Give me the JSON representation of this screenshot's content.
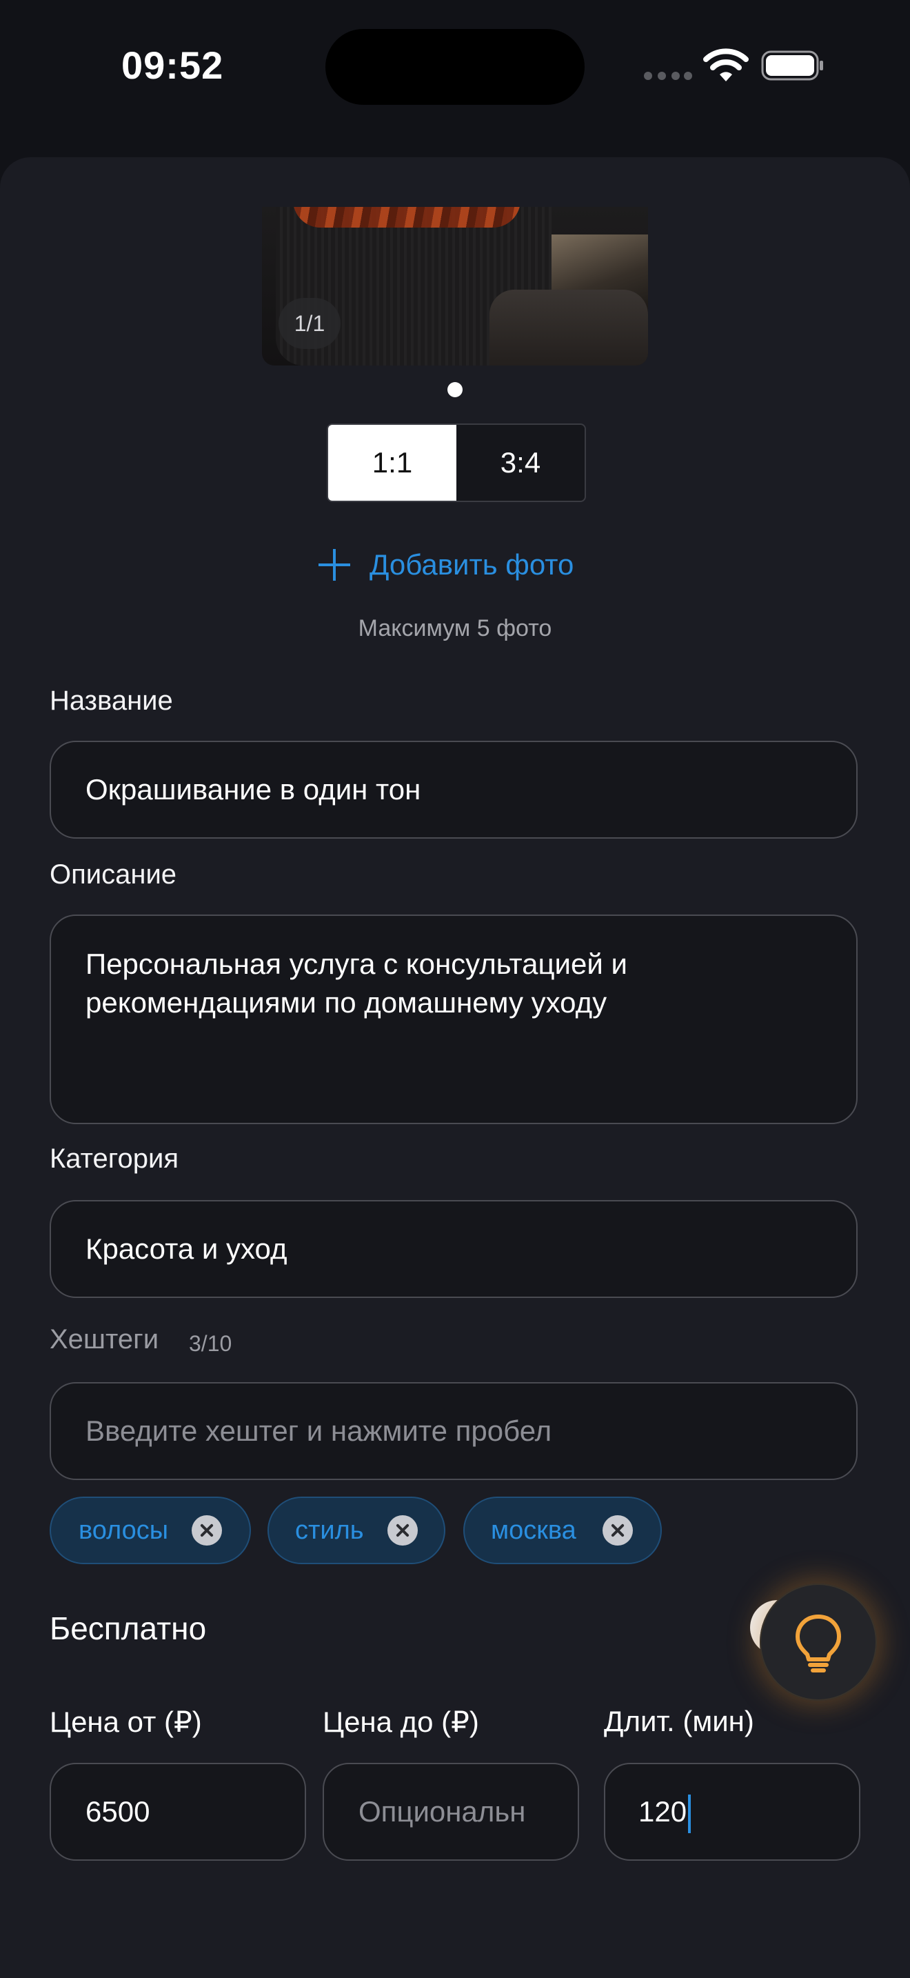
{
  "status_bar": {
    "time": "09:52"
  },
  "gallery": {
    "counter": "1/1"
  },
  "aspect": {
    "options": [
      "1:1",
      "3:4"
    ],
    "selected": "1:1"
  },
  "add_photo": {
    "label": "Добавить фото",
    "hint": "Максимум 5 фото"
  },
  "form": {
    "name": {
      "label": "Название",
      "value": "Окрашивание в один тон"
    },
    "description": {
      "label": "Описание",
      "value": "Персональная услуга с консультацией и рекомендациями по домашнему уходу"
    },
    "category": {
      "label": "Категория",
      "value": "Красота и уход"
    },
    "hashtags": {
      "label": "Хештеги",
      "count": "3/10",
      "placeholder": "Введите хештег и нажмите пробел",
      "tags": [
        "волосы",
        "стиль",
        "москва"
      ]
    },
    "free": {
      "label": "Бесплатно"
    },
    "price_from": {
      "label": "Цена от (₽)",
      "value": "6500"
    },
    "price_to": {
      "label": "Цена до (₽)",
      "placeholder": "Опциональн"
    },
    "duration": {
      "label": "Длит. (мин)",
      "value": "120"
    }
  },
  "colors": {
    "accent": "#2a8fe0",
    "background": "#1b1c23",
    "fab_glow": "#f2a33a"
  },
  "icons": {
    "fab": "lightbulb-icon",
    "add": "plus-icon",
    "chip_remove": "close-icon"
  }
}
